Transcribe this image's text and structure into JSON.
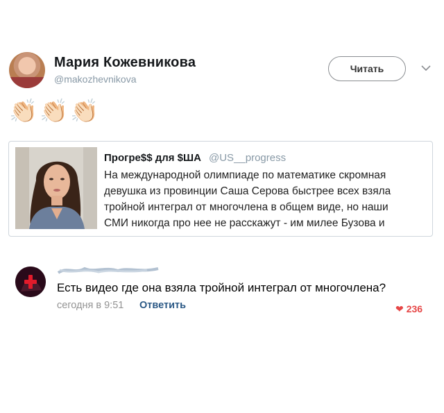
{
  "tweet": {
    "author_name": "Мария Кожевникова",
    "author_handle": "@makozhevnikova",
    "follow_label": "Читать",
    "emojis": [
      "👏🏻",
      "👏🏻",
      "👏🏻"
    ],
    "quoted": {
      "author_name": "Прогре$$ для $ША",
      "author_handle": "@US__progress",
      "lines": [
        "На международной олимпиаде по математике скромная",
        "девушка из провинции Саша Серова быстрее всех взяла",
        "тройной интеграл от многочлена в общем виде, но наши",
        "СМИ никогда про нее не расскажут - им милее Бузова и"
      ]
    }
  },
  "comment": {
    "text": "Есть видео где она взяла тройной интеграл от многочлена?",
    "time": "сегодня в 9:51",
    "reply_label": "Ответить",
    "likes": "236"
  },
  "colors": {
    "like": "#e64646",
    "link": "#2a5885",
    "muted": "#8899a6"
  },
  "icons": {
    "chevron": "chevron-down-icon",
    "heart": "heart-icon"
  }
}
